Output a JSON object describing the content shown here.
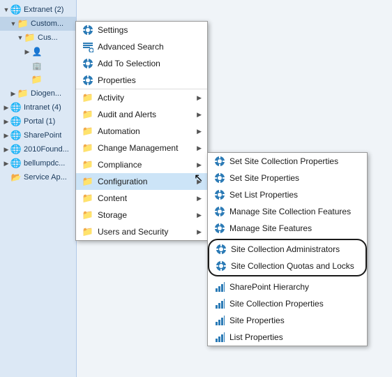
{
  "tree": {
    "items": [
      {
        "id": "extranet",
        "label": "Extranet (2)",
        "level": 1,
        "icon": "globe",
        "expanded": true,
        "hasArrow": true
      },
      {
        "id": "custom1",
        "label": "Custom...",
        "level": 2,
        "icon": "folder",
        "expanded": true,
        "hasArrow": true,
        "selected": true
      },
      {
        "id": "cus1",
        "label": "Cus...",
        "level": 3,
        "icon": "folder",
        "expanded": true,
        "hasArrow": true
      },
      {
        "id": "person1",
        "label": "",
        "level": 4,
        "icon": "person",
        "hasArrow": true
      },
      {
        "id": "building1",
        "label": "",
        "level": 4,
        "icon": "building",
        "hasArrow": false
      },
      {
        "id": "folder2",
        "label": "",
        "level": 4,
        "icon": "folder",
        "hasArrow": false
      },
      {
        "id": "diogen",
        "label": "Diogen...",
        "level": 2,
        "icon": "folder",
        "hasArrow": true
      },
      {
        "id": "intranet",
        "label": "Intranet (4)",
        "level": 1,
        "icon": "globe",
        "hasArrow": true
      },
      {
        "id": "portal",
        "label": "Portal (1)",
        "level": 1,
        "icon": "globe",
        "hasArrow": true
      },
      {
        "id": "sharepoint",
        "label": "SharePoint",
        "level": 1,
        "icon": "globe",
        "hasArrow": true
      },
      {
        "id": "2010found",
        "label": "2010Found...",
        "level": 1,
        "icon": "globe",
        "hasArrow": true
      },
      {
        "id": "bellumc",
        "label": "bellumpdc...",
        "level": 1,
        "icon": "globe",
        "hasArrow": true
      },
      {
        "id": "serviceapp",
        "label": "Service Ap...",
        "level": 1,
        "icon": "folder",
        "hasArrow": false
      }
    ]
  },
  "contextMenu": {
    "items": [
      {
        "id": "settings",
        "label": "Settings",
        "icon": "gear"
      },
      {
        "id": "advanced-search",
        "label": "Advanced Search",
        "icon": "advanced"
      },
      {
        "id": "add-to-selection",
        "label": "Add To Selection",
        "icon": "gear"
      },
      {
        "id": "properties",
        "label": "Properties",
        "icon": "gear"
      },
      {
        "id": "activity",
        "label": "Activity",
        "icon": "folder-blue",
        "hasArrow": true
      },
      {
        "id": "audit-alerts",
        "label": "Audit and Alerts",
        "icon": "folder-blue",
        "hasArrow": true
      },
      {
        "id": "automation",
        "label": "Automation",
        "icon": "folder-blue",
        "hasArrow": true
      },
      {
        "id": "change-mgmt",
        "label": "Change Management",
        "icon": "folder-blue",
        "hasArrow": true
      },
      {
        "id": "compliance",
        "label": "Compliance",
        "icon": "folder-blue",
        "hasArrow": true
      },
      {
        "id": "configuration",
        "label": "Configuration",
        "icon": "folder-blue",
        "hasArrow": true,
        "highlighted": true
      },
      {
        "id": "content",
        "label": "Content",
        "icon": "folder-blue",
        "hasArrow": true
      },
      {
        "id": "storage",
        "label": "Storage",
        "icon": "folder-blue",
        "hasArrow": true
      },
      {
        "id": "users-security",
        "label": "Users and Security",
        "icon": "folder-blue",
        "hasArrow": true
      }
    ]
  },
  "submenu": {
    "items": [
      {
        "id": "set-site-coll-props",
        "label": "Set Site Collection Properties",
        "icon": "gear"
      },
      {
        "id": "set-site-props",
        "label": "Set Site Properties",
        "icon": "gear"
      },
      {
        "id": "set-list-props",
        "label": "Set List Properties",
        "icon": "gear"
      },
      {
        "id": "manage-site-coll-features",
        "label": "Manage Site Collection Features",
        "icon": "gear"
      },
      {
        "id": "manage-site-features",
        "label": "Manage Site Features",
        "icon": "gear"
      },
      {
        "id": "site-coll-admins",
        "label": "Site Collection Administrators",
        "icon": "gear",
        "circled": true
      },
      {
        "id": "site-coll-quotas",
        "label": "Site Collection Quotas and Locks",
        "icon": "gear",
        "circled": true
      },
      {
        "id": "sharepoint-hierarchy",
        "label": "SharePoint Hierarchy",
        "icon": "chart"
      },
      {
        "id": "site-coll-props2",
        "label": "Site Collection Properties",
        "icon": "chart"
      },
      {
        "id": "site-props2",
        "label": "Site Properties",
        "icon": "chart"
      },
      {
        "id": "list-props2",
        "label": "List Properties",
        "icon": "chart"
      }
    ]
  }
}
